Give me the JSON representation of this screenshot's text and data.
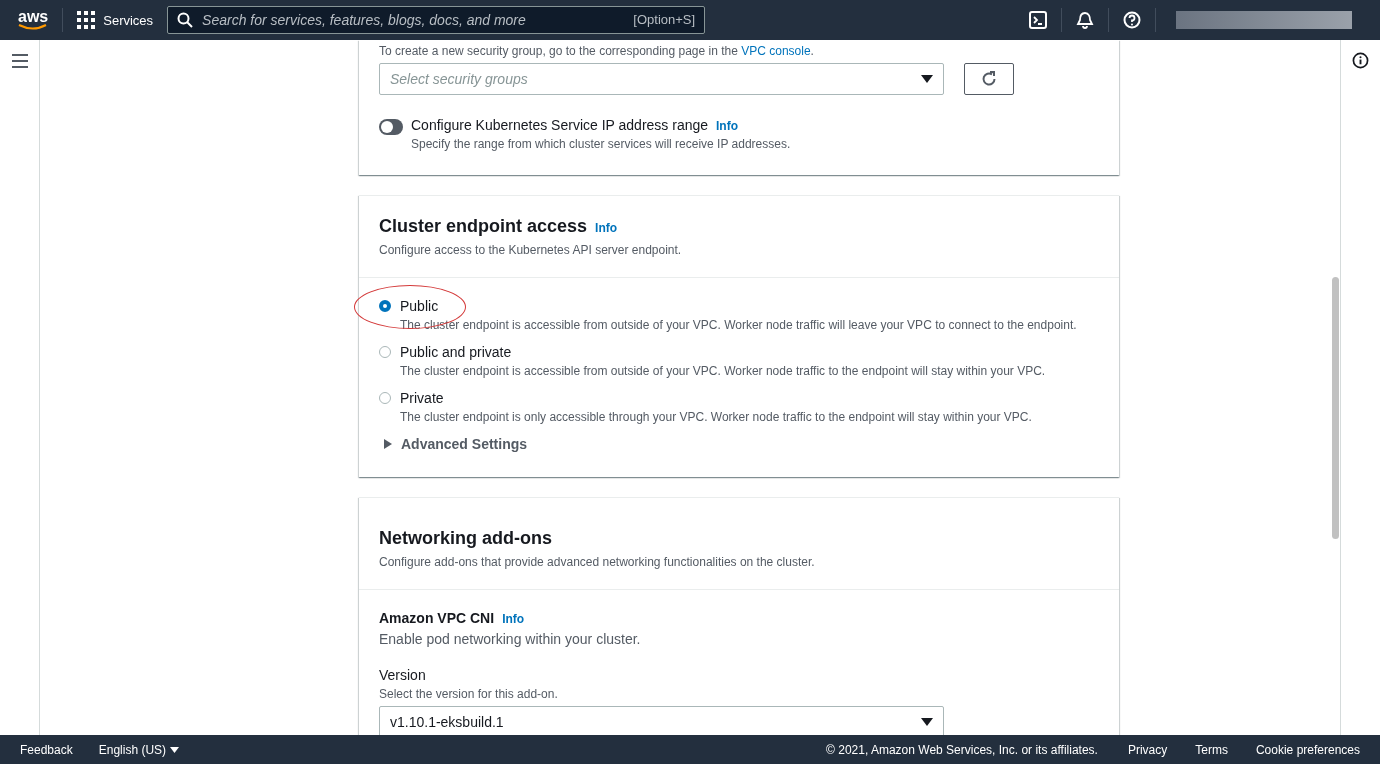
{
  "nav": {
    "logo": "aws",
    "services": "Services",
    "search_placeholder": "Search for services, features, blogs, docs, and more",
    "shortcut": "[Option+S]"
  },
  "security_groups": {
    "hint": "To create a new security group, go to the corresponding page in the",
    "hint_link": "VPC console",
    "hint_end": ".",
    "select_placeholder": "Select security groups",
    "toggle": {
      "label": "Configure Kubernetes Service IP address range",
      "info": "Info",
      "description": "Specify the range from which cluster services will receive IP addresses.",
      "on": false
    }
  },
  "endpoint_access": {
    "title": "Cluster endpoint access",
    "info": "Info",
    "description": "Configure access to the Kubernetes API server endpoint.",
    "options": [
      {
        "label": "Public",
        "description": "The cluster endpoint is accessible from outside of your VPC. Worker node traffic will leave your VPC to connect to the endpoint.",
        "selected": true
      },
      {
        "label": "Public and private",
        "description": "The cluster endpoint is accessible from outside of your VPC. Worker node traffic to the endpoint will stay within your VPC.",
        "selected": false
      },
      {
        "label": "Private",
        "description": "The cluster endpoint is only accessible through your VPC. Worker node traffic to the endpoint will stay within your VPC.",
        "selected": false
      }
    ],
    "advanced": {
      "label": "Advanced Settings",
      "expanded": false
    }
  },
  "networking": {
    "title": "Networking add-ons",
    "description": "Configure add-ons that provide advanced networking functionalities on the cluster.",
    "addon": {
      "name": "Amazon VPC CNI",
      "info": "Info",
      "description": "Enable pod networking within your cluster.",
      "version_label": "Version",
      "version_hint": "Select the version for this add-on.",
      "version_value": "v1.10.1-eksbuild.1"
    }
  },
  "footer": {
    "feedback": "Feedback",
    "language": "English (US)",
    "copyright": "© 2021, Amazon Web Services, Inc. or its affiliates.",
    "links": [
      "Privacy",
      "Terms",
      "Cookie preferences"
    ]
  }
}
